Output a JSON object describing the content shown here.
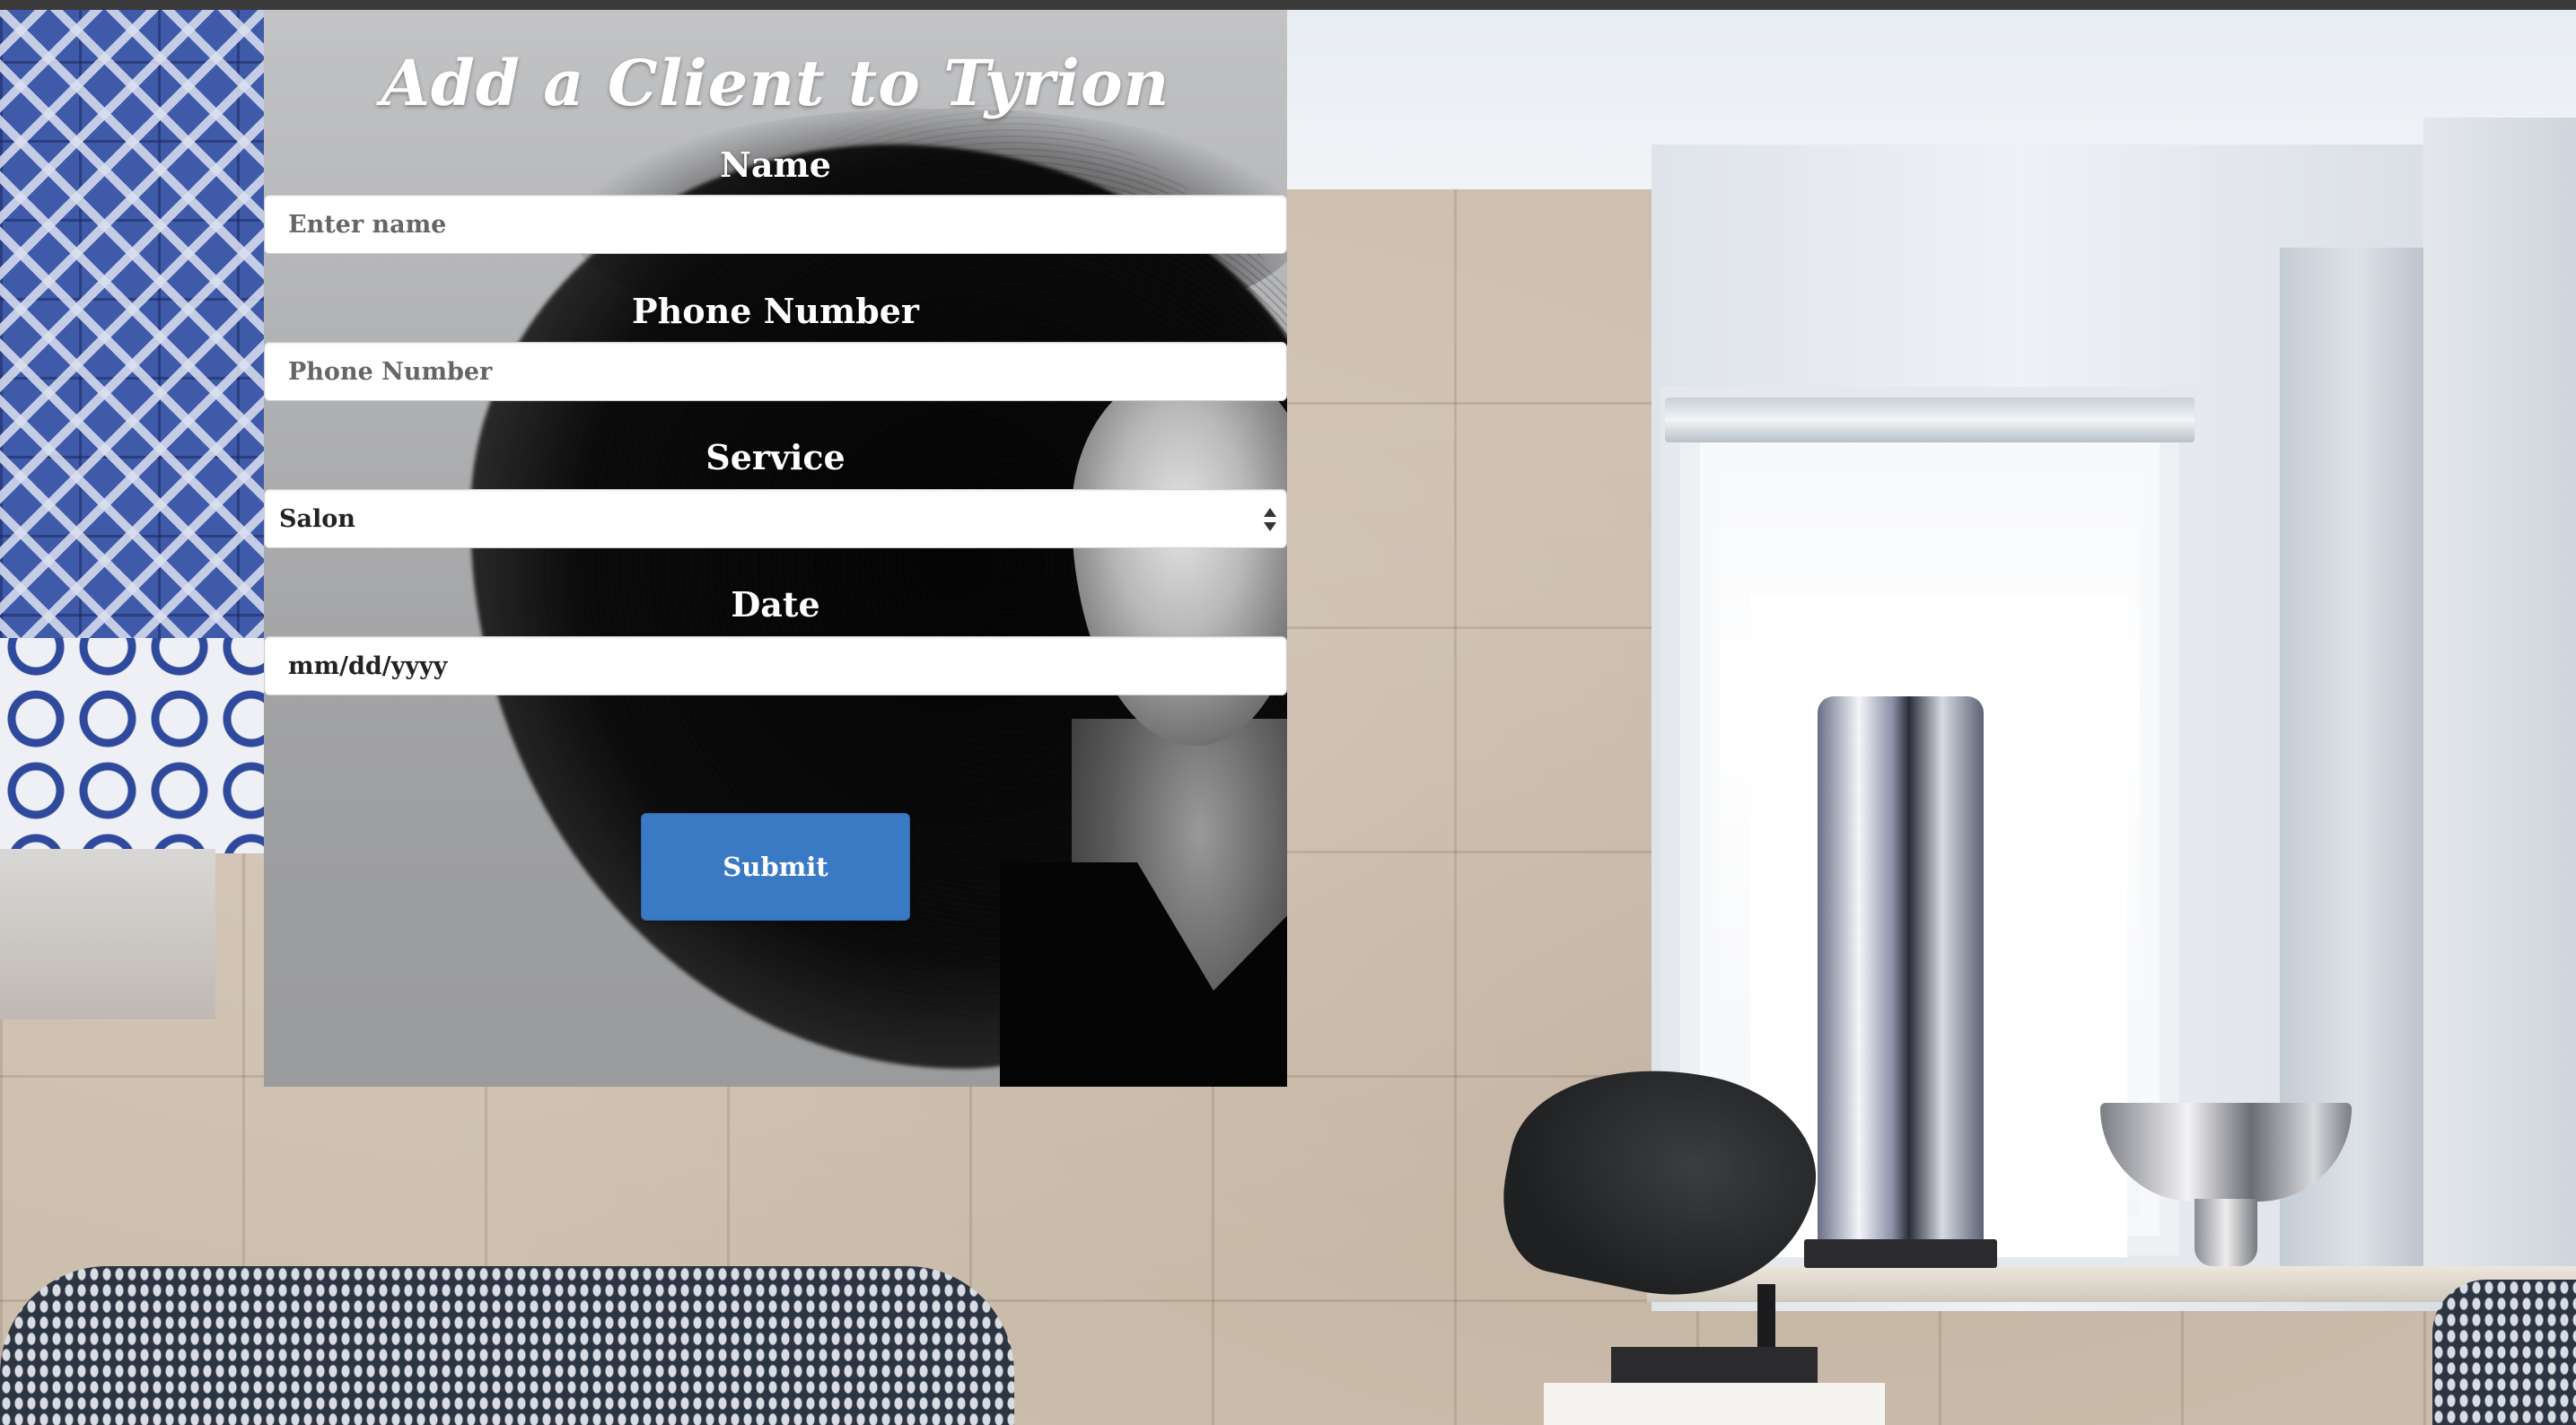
{
  "form": {
    "title": "Add a Client to Tyrion",
    "fields": {
      "name": {
        "label": "Name",
        "placeholder": "Enter name",
        "value": ""
      },
      "phone": {
        "label": "Phone Number",
        "placeholder": "Phone Number",
        "value": ""
      },
      "service": {
        "label": "Service",
        "selected": "Salon"
      },
      "date": {
        "label": "Date",
        "placeholder": "mm/dd/yyyy",
        "value": ""
      }
    },
    "submit_label": "Submit"
  },
  "colors": {
    "button": "#3a7ac4",
    "label_text": "#ffffff",
    "input_background": "#ffffff"
  },
  "icons": {
    "select_arrows": "select-up-down-arrows-icon"
  }
}
